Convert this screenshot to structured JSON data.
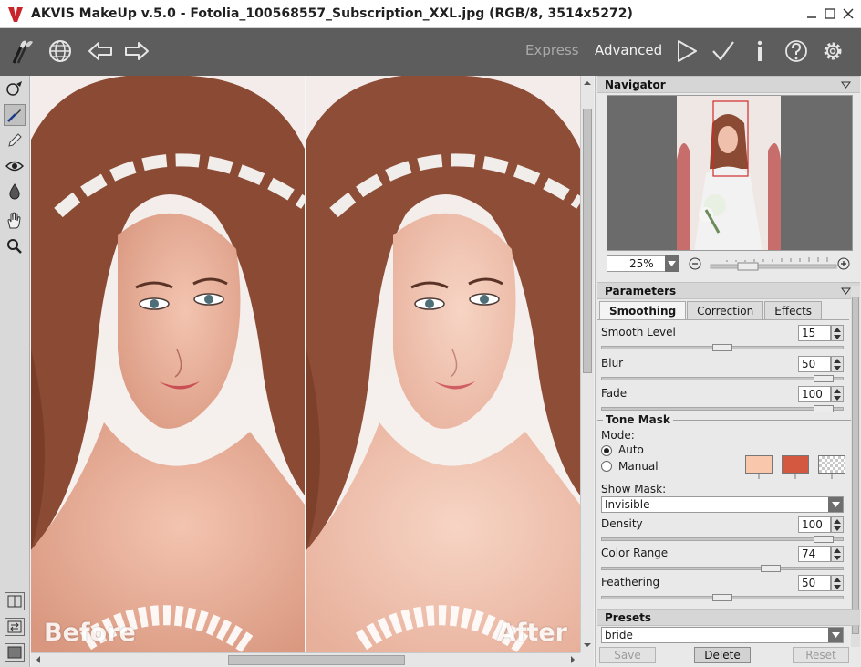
{
  "window": {
    "title": "AKVIS MakeUp v.5.0 - Fotolia_100568557_Subscription_XXL.jpg (RGB/8, 3514x5272)"
  },
  "toolbar": {
    "mode_express": "Express",
    "mode_advanced": "Advanced"
  },
  "canvas": {
    "before_label": "Before",
    "after_label": "After"
  },
  "navigator": {
    "title": "Navigator",
    "zoom": "25%"
  },
  "parameters": {
    "title": "Parameters",
    "tabs": [
      "Smoothing",
      "Correction",
      "Effects"
    ],
    "smooth_level": {
      "label": "Smooth Level",
      "value": "15",
      "level": 0.5
    },
    "blur": {
      "label": "Blur",
      "value": "50",
      "level": 0.96
    },
    "fade": {
      "label": "Fade",
      "value": "100",
      "level": 0.96
    },
    "tone_mask": {
      "title": "Tone Mask",
      "mode_label": "Mode:",
      "auto_label": "Auto",
      "manual_label": "Manual",
      "colors": [
        "#f9c7ab",
        "#d4583f"
      ],
      "show_mask_label": "Show Mask:",
      "show_mask_value": "Invisible",
      "density": {
        "label": "Density",
        "value": "100",
        "level": 0.96
      },
      "color_range": {
        "label": "Color Range",
        "value": "74",
        "level": 0.72
      },
      "feathering": {
        "label": "Feathering",
        "value": "50",
        "level": 0.5
      }
    }
  },
  "presets": {
    "title": "Presets",
    "value": "bride",
    "save": "Save",
    "delete": "Delete",
    "reset": "Reset"
  }
}
